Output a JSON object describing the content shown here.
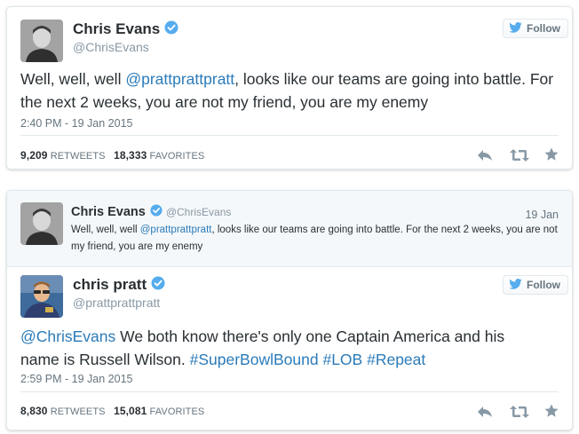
{
  "tweet1": {
    "name": "Chris Evans",
    "handle": "@ChrisEvans",
    "follow_label": "Follow",
    "text_before": "Well, well, well ",
    "mention": "@prattprattpratt",
    "text_after": ", looks like our teams are going into battle. For the next 2 weeks, you are not my friend, you are my enemy",
    "timestamp": "2:40 PM - 19 Jan 2015",
    "retweets_count": "9,209",
    "retweets_label": "RETWEETS",
    "favorites_count": "18,333",
    "favorites_label": "FAVORITES"
  },
  "tweet2": {
    "quoted": {
      "name": "Chris Evans",
      "handle": "@ChrisEvans",
      "date": "19 Jan",
      "text_before": "Well, well, well ",
      "mention": "@prattprattpratt",
      "text_after": ", looks like our teams are going into battle. For the next 2 weeks, you are not my friend, you are my enemy"
    },
    "name": "chris pratt",
    "handle": "@prattprattpratt",
    "follow_label": "Follow",
    "mention": "@ChrisEvans",
    "text_mid": " We both know there's only one Captain America and his name is Russell Wilson. ",
    "hashtag1": "#SuperBowlBound",
    "hashtag2": "#LOB",
    "hashtag3": "#Repeat",
    "timestamp": "2:59 PM - 19 Jan 2015",
    "retweets_count": "8,830",
    "retweets_label": "RETWEETS",
    "favorites_count": "15,081",
    "favorites_label": "FAVORITES"
  },
  "icons": {
    "verified": "verified-badge-icon",
    "bird": "twitter-bird-icon",
    "reply": "reply-icon",
    "retweet": "retweet-icon",
    "favorite": "star-icon"
  },
  "colors": {
    "link": "#2b7bb9",
    "verified": "#55acee",
    "bird": "#55acee",
    "text": "#292f33",
    "muted": "#66757f",
    "quote_bg": "#f5f8fa",
    "border": "#e1e8ed"
  }
}
